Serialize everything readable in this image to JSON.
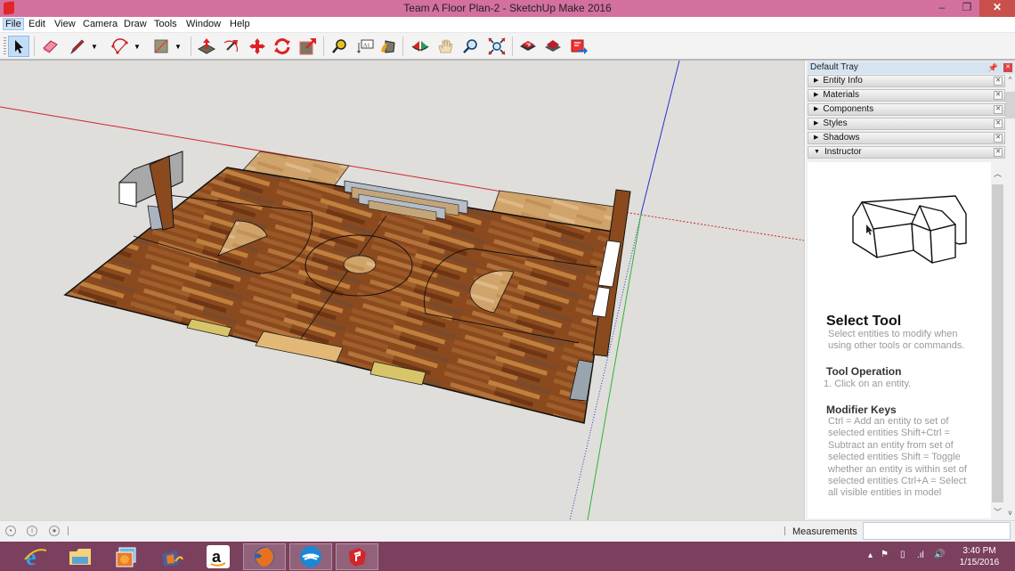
{
  "window": {
    "title": "Team A Floor Plan-2 - SketchUp Make 2016",
    "controls": {
      "minimize": "‒",
      "restore": "❐",
      "close": "✕"
    }
  },
  "menu": {
    "items": [
      "File",
      "Edit",
      "View",
      "Camera",
      "Draw",
      "Tools",
      "Window",
      "Help"
    ],
    "active": "File"
  },
  "toolbar": {
    "tools": [
      {
        "name": "select",
        "label": "Select",
        "active": true
      },
      {
        "name": "eraser",
        "label": "Eraser"
      },
      {
        "name": "line",
        "label": "Line"
      },
      {
        "name": "arc",
        "label": "Arc"
      },
      {
        "name": "rectangle",
        "label": "Rectangle"
      },
      {
        "name": "push-pull",
        "label": "Push/Pull"
      },
      {
        "name": "offset",
        "label": "Offset"
      },
      {
        "name": "move",
        "label": "Move"
      },
      {
        "name": "rotate",
        "label": "Rotate"
      },
      {
        "name": "scale",
        "label": "Scale"
      },
      {
        "name": "tape-measure",
        "label": "Tape Measure"
      },
      {
        "name": "text",
        "label": "Text",
        "glyph": "A1"
      },
      {
        "name": "paint-bucket",
        "label": "Paint Bucket"
      },
      {
        "name": "orbit",
        "label": "Orbit"
      },
      {
        "name": "pan",
        "label": "Pan"
      },
      {
        "name": "zoom",
        "label": "Zoom"
      },
      {
        "name": "zoom-extents",
        "label": "Zoom Extents"
      },
      {
        "name": "3d-warehouse",
        "label": "3D Warehouse"
      },
      {
        "name": "extension-warehouse",
        "label": "Extension Warehouse"
      },
      {
        "name": "send-to-layout",
        "label": "Send to LayOut"
      }
    ]
  },
  "viewport": {
    "model": "basketball court floor plan",
    "axis_colors": {
      "red": "#d0252a",
      "green": "#2fb52f",
      "blue": "#2c2ccf"
    },
    "background": "#dfdedb"
  },
  "tray": {
    "title": "Default Tray",
    "panels": [
      {
        "label": "Entity Info",
        "expanded": false
      },
      {
        "label": "Materials",
        "expanded": false
      },
      {
        "label": "Components",
        "expanded": false
      },
      {
        "label": "Styles",
        "expanded": false
      },
      {
        "label": "Shadows",
        "expanded": false
      },
      {
        "label": "Instructor",
        "expanded": true
      }
    ],
    "instructor": {
      "title": "Select Tool",
      "description": "Select entities to modify when using other tools or commands.",
      "operation_heading": "Tool Operation",
      "operation_step": "1.   Click on an entity.",
      "modifier_heading": "Modifier Keys",
      "modifiers": "Ctrl = Add an entity to set of selected entities Shift+Ctrl = Subtract an entity from set of selected entities Shift = Toggle whether an entity is within set of selected entities Ctrl+A = Select all visible entities in model"
    }
  },
  "status": {
    "measurements_label": "Measurements",
    "measurements_value": ""
  },
  "taskbar": {
    "apps": [
      {
        "name": "internet-explorer",
        "open": false
      },
      {
        "name": "file-explorer",
        "open": false
      },
      {
        "name": "photo-gallery",
        "open": false
      },
      {
        "name": "movie-maker",
        "open": false
      },
      {
        "name": "amazon",
        "open": false
      },
      {
        "name": "firefox",
        "open": true
      },
      {
        "name": "openoffice",
        "open": true
      },
      {
        "name": "sketchup",
        "open": true
      }
    ],
    "clock_time": "3:40 PM",
    "clock_date": "1/15/2016"
  }
}
